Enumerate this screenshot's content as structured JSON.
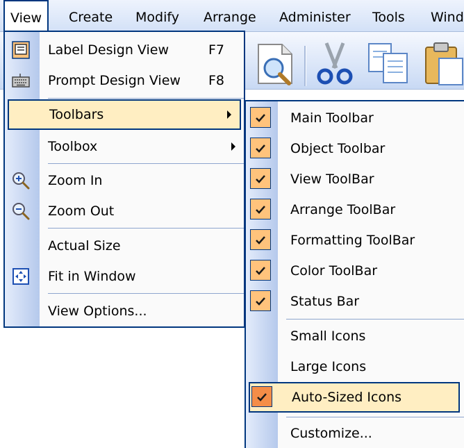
{
  "menubar": {
    "items": [
      {
        "label": "View"
      },
      {
        "label": "Create"
      },
      {
        "label": "Modify"
      },
      {
        "label": "Arrange"
      },
      {
        "label": "Administer"
      },
      {
        "label": "Tools"
      },
      {
        "label": "Windo"
      }
    ]
  },
  "toolbar_icons": [
    "print-preview-icon",
    "cut-icon",
    "copy-icon",
    "paste-icon"
  ],
  "view_menu": {
    "items": [
      {
        "label": "Label Design View",
        "shortcut": "F7",
        "icon": "label-design-icon"
      },
      {
        "label": "Prompt Design View",
        "shortcut": "F8",
        "icon": "keyboard-icon"
      },
      {
        "label": "Toolbars"
      },
      {
        "label": "Toolbox"
      },
      {
        "label": "Zoom In",
        "icon": "zoom-in-icon"
      },
      {
        "label": "Zoom Out",
        "icon": "zoom-out-icon"
      },
      {
        "label": "Actual Size"
      },
      {
        "label": "Fit in Window",
        "icon": "fit-window-icon"
      },
      {
        "label": "View Options..."
      }
    ]
  },
  "toolbars_submenu": {
    "items": [
      {
        "label": "Main Toolbar",
        "checked": true
      },
      {
        "label": "Object Toolbar",
        "checked": true
      },
      {
        "label": "View ToolBar",
        "checked": true
      },
      {
        "label": "Arrange ToolBar",
        "checked": true
      },
      {
        "label": "Formatting ToolBar",
        "checked": true
      },
      {
        "label": "Color ToolBar",
        "checked": true
      },
      {
        "label": "Status Bar",
        "checked": true
      },
      {
        "label": "Small Icons",
        "checked": false
      },
      {
        "label": "Large Icons",
        "checked": false
      },
      {
        "label": "Auto-Sized Icons",
        "checked": true
      },
      {
        "label": "Customize...",
        "checked": false
      }
    ]
  },
  "colors": {
    "highlight": "#ffeec2",
    "border": "#00367e",
    "check": "#ffc37c"
  }
}
